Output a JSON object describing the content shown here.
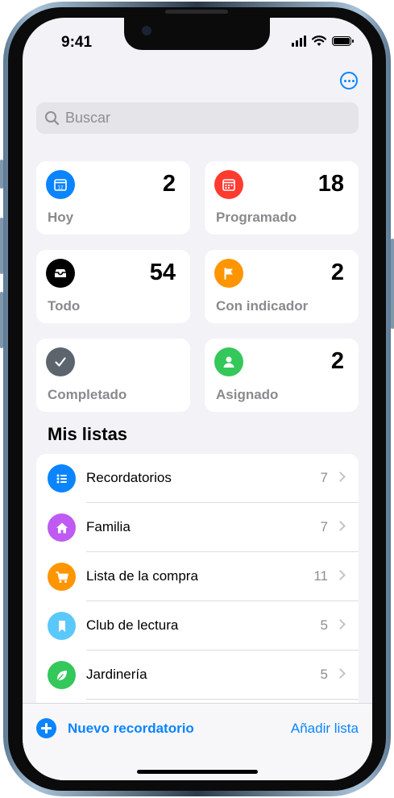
{
  "status": {
    "time": "9:41"
  },
  "header": {
    "more_icon": "ellipsis-circle-icon",
    "accent": "#0a84ff"
  },
  "search": {
    "placeholder": "Buscar"
  },
  "tiles": [
    {
      "label": "Hoy",
      "count": "2",
      "color": "#0a84ff",
      "icon": "calendar-today-icon"
    },
    {
      "label": "Programado",
      "count": "18",
      "color": "#ff3b30",
      "icon": "calendar-icon"
    },
    {
      "label": "Todo",
      "count": "54",
      "color": "#000000",
      "icon": "tray-icon"
    },
    {
      "label": "Con indicador",
      "count": "2",
      "color": "#ff9500",
      "icon": "flag-icon"
    },
    {
      "label": "Completado",
      "count": "",
      "color": "#5c646e",
      "icon": "checkmark-icon"
    },
    {
      "label": "Asignado",
      "count": "2",
      "color": "#34c759",
      "icon": "person-icon"
    }
  ],
  "my_lists": {
    "title": "Mis listas",
    "items": [
      {
        "name": "Recordatorios",
        "count": "7",
        "color": "#0a84ff",
        "icon": "list-icon"
      },
      {
        "name": "Familia",
        "count": "7",
        "color": "#bf5af2",
        "icon": "house-icon"
      },
      {
        "name": "Lista de la compra",
        "count": "11",
        "color": "#ff9500",
        "icon": "cart-icon"
      },
      {
        "name": "Club de lectura",
        "count": "5",
        "color": "#5ac8fa",
        "icon": "bookmark-icon"
      },
      {
        "name": "Jardinería",
        "count": "5",
        "color": "#34c759",
        "icon": "leaf-icon"
      }
    ]
  },
  "toolbar": {
    "new_reminder": "Nuevo recordatorio",
    "add_list": "Añadir lista"
  }
}
